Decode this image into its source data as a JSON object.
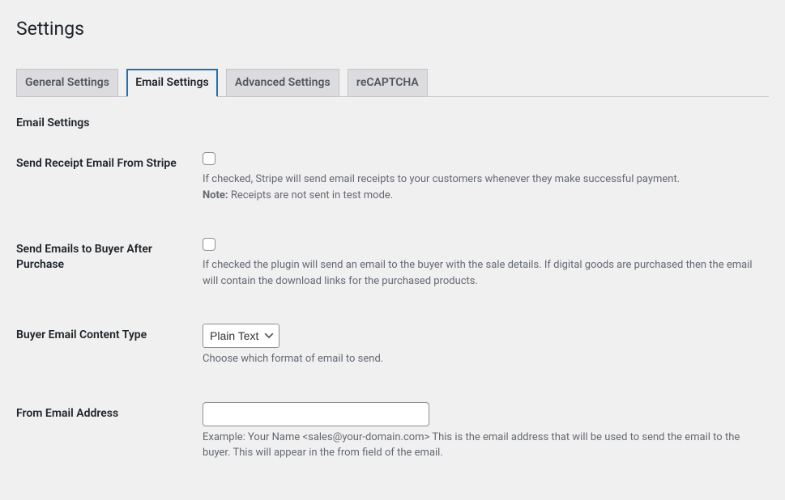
{
  "page_title": "Settings",
  "tabs": [
    {
      "label": "General Settings"
    },
    {
      "label": "Email Settings"
    },
    {
      "label": "Advanced Settings"
    },
    {
      "label": "reCAPTCHA"
    }
  ],
  "section_heading": "Email Settings",
  "fields": {
    "stripe_receipt": {
      "label": "Send Receipt Email From Stripe",
      "desc_prefix": "If checked, Stripe will send email receipts to your customers whenever they make successful payment.",
      "note_label": "Note:",
      "note_text": " Receipts are not sent in test mode."
    },
    "buyer_emails": {
      "label": "Send Emails to Buyer After Purchase",
      "desc": "If checked the plugin will send an email to the buyer with the sale details. If digital goods are purchased then the email will contain the download links for the purchased products."
    },
    "content_type": {
      "label": "Buyer Email Content Type",
      "selected": "Plain Text",
      "desc": "Choose which format of email to send."
    },
    "from_address": {
      "label": "From Email Address",
      "value": "",
      "desc": "Example: Your Name <sales@your-domain.com> This is the email address that will be used to send the email to the buyer. This will appear in the from field of the email."
    }
  }
}
